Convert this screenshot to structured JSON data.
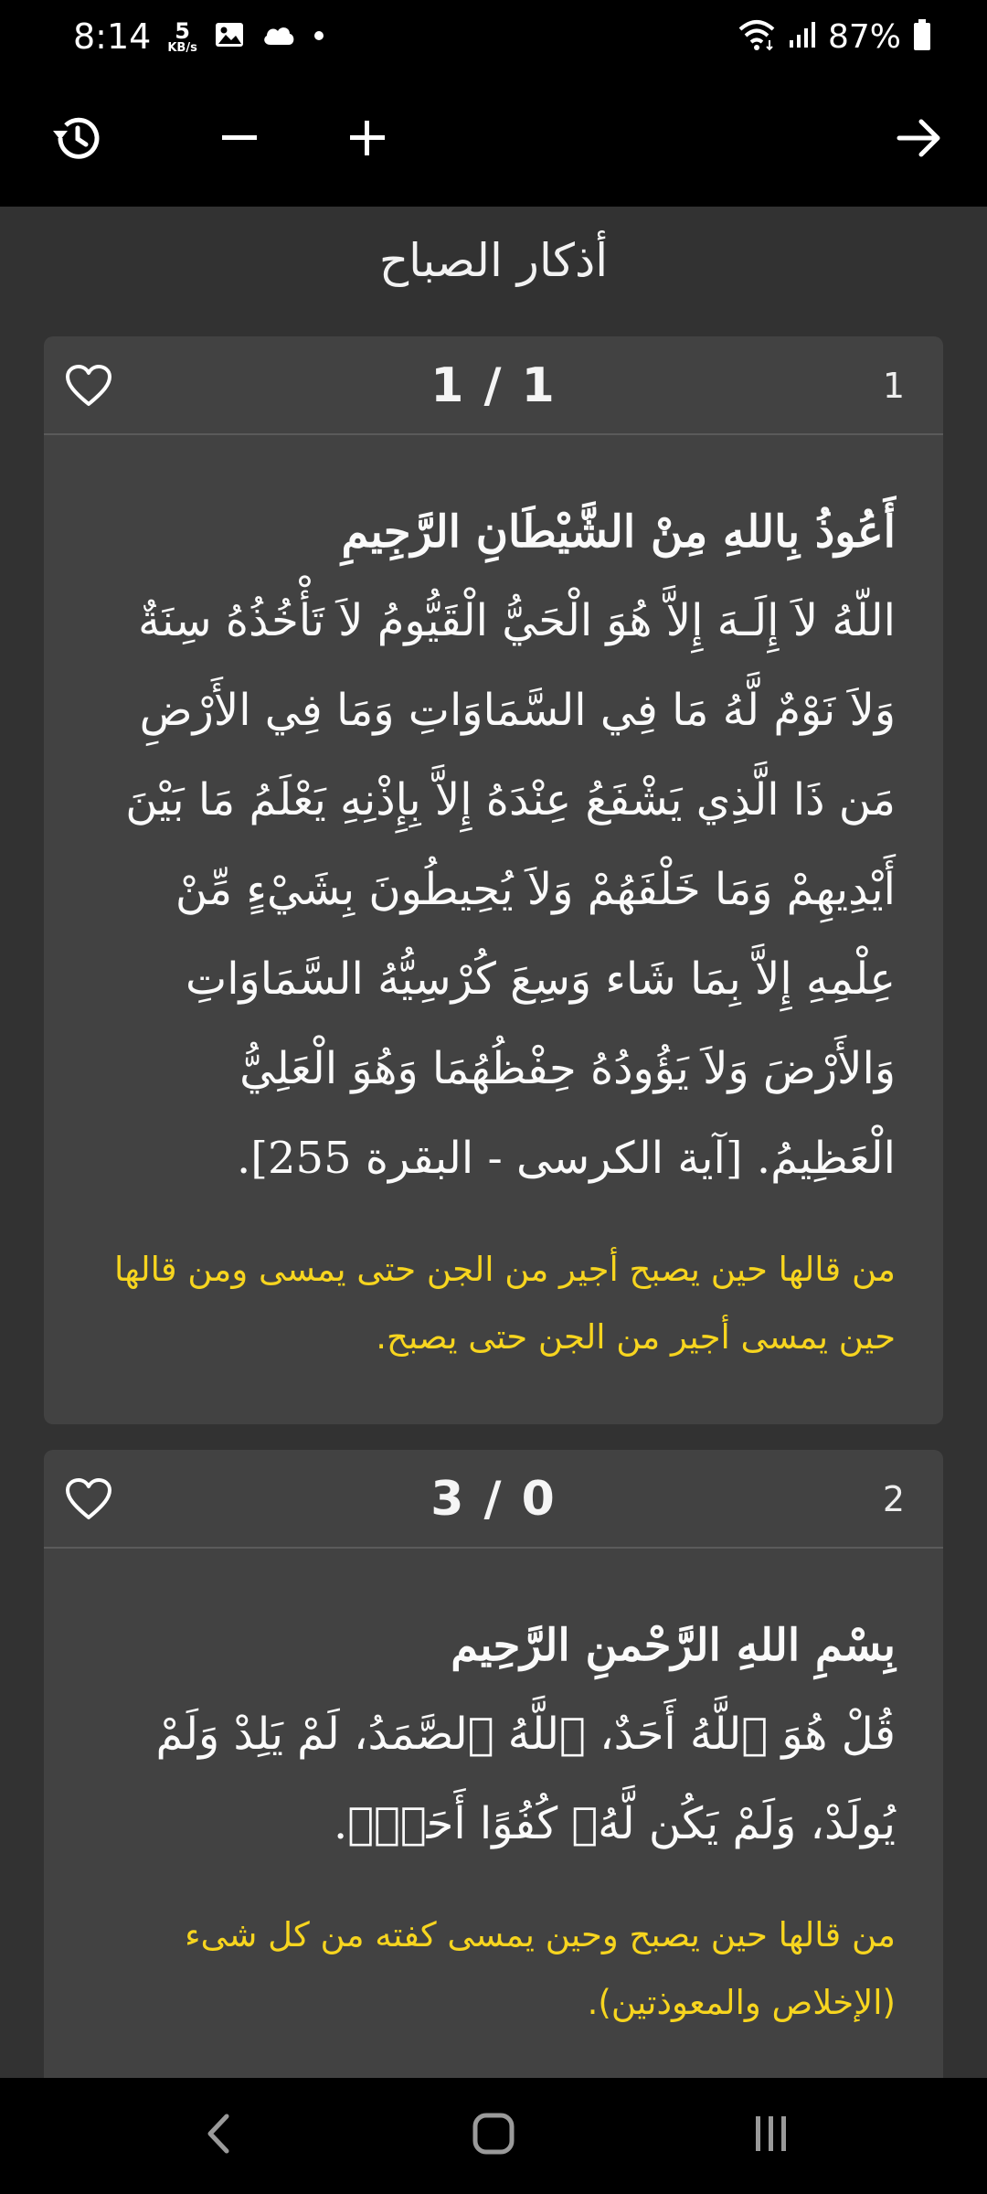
{
  "status_bar": {
    "time": "8:14",
    "speed_value": "5",
    "speed_unit": "KB/s",
    "battery": "87%",
    "icons": [
      "image-icon",
      "cloud-icon",
      "dot-icon",
      "wifi-icon",
      "signal-icon",
      "battery-icon"
    ]
  },
  "toolbar": {
    "icons": [
      "history-icon",
      "minus-icon",
      "plus-icon",
      "arrow-right-icon"
    ]
  },
  "page": {
    "title": "أذكار الصباح"
  },
  "cards": [
    {
      "index": "1",
      "counter": "1 / 1",
      "title": "أَعُوذُ بِاللهِ مِنْ الشَّيْطَانِ الرَّجِيمِ",
      "text": "اللّهُ لاَ إِلَـهَ إِلاَّ هُوَ الْحَيُّ الْقَيُّومُ لاَ تَأْخُذُهُ سِنَةٌ وَلاَ نَوْمٌ لَّهُ مَا فِي السَّمَاوَاتِ وَمَا فِي الأَرْضِ مَن ذَا الَّذِي يَشْفَعُ عِنْدَهُ إِلاَّ بِإِذْنِهِ يَعْلَمُ مَا بَيْنَ أَيْدِيهِمْ وَمَا خَلْفَهُمْ وَلاَ يُحِيطُونَ بِشَيْءٍ مِّنْ عِلْمِهِ إِلاَّ بِمَا شَاء وَسِعَ كُرْسِيُّهُ السَّمَاوَاتِ وَالأَرْضَ وَلاَ يَؤُودُهُ حِفْظُهُمَا وَهُوَ الْعَلِيُّ الْعَظِيمُ. [آية الكرسى - البقرة 255].",
      "note": "من قالها حين يصبح أجير من الجن حتى يمسى ومن قالها حين يمسى أجير من الجن حتى يصبح."
    },
    {
      "index": "2",
      "counter": "3 / 0",
      "title": "بِسْمِ اللهِ الرَّحْمنِ الرَّحِيم",
      "text": "قُلْ هُوَ ٱللَّهُ أَحَدٌ، ٱللَّهُ ٱلصَّمَدُ، لَمْ يَلِدْ وَلَمْ يُولَدْ، وَلَمْ يَكُن لَّهُۥ كُفُوًا أَحَدٌۢ.",
      "note": "من قالها حين يصبح وحين يمسى كفته من كل شىء (الإخلاص والمعوذتين)."
    }
  ],
  "nav_bar": {
    "icons": [
      "back-icon",
      "home-icon",
      "recents-icon"
    ]
  },
  "colors": {
    "background": "#323232",
    "card": "#424242",
    "note_text": "#f7d51f",
    "bars": "#000000"
  }
}
